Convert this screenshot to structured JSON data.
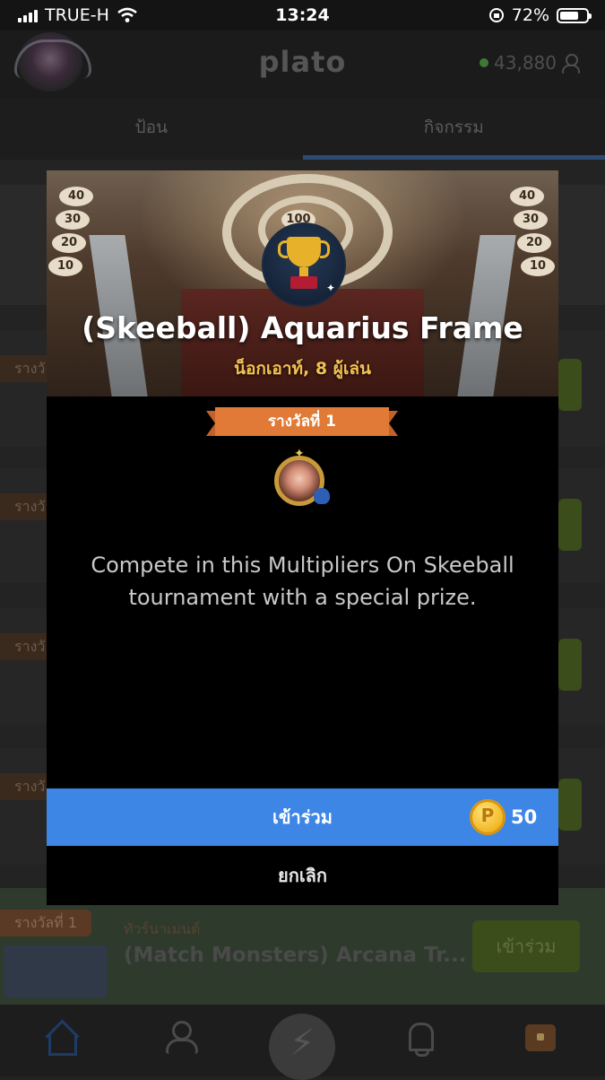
{
  "status_bar": {
    "carrier": "TRUE-H",
    "time": "13:24",
    "battery_percent": "72%",
    "battery_level": 0.72
  },
  "header": {
    "logo": "plato",
    "coins": "43,880"
  },
  "tabs": [
    {
      "label": "ป้อน"
    },
    {
      "label": "กิจกรรม"
    }
  ],
  "background_list": {
    "visible_row": {
      "badge": "รางวัลที่ 1",
      "subtitle": "ทัวร์นาเมนต์",
      "title": "(Match Monsters) Arcana Tr...",
      "button": "เข้าร่วม"
    },
    "partial_badges": [
      "รางวั",
      "รางวั",
      "รางวั",
      "รางวั"
    ]
  },
  "modal": {
    "hero_title": "(Skeeball) Aquarius Frame",
    "hero_subtitle": "น็อกเอาท์, 8 ผู้เล่น",
    "score_labels": {
      "l40": "40",
      "l30": "30",
      "l20": "20",
      "l10": "10",
      "l100": "100",
      "r40": "40",
      "r30": "30",
      "r20": "20",
      "r10": "10"
    },
    "prize_label": "รางวัลที่ 1",
    "description": "Compete in this Multipliers On Skeeball tournament with a special prize.",
    "join_label": "เข้าร่วม",
    "coin_symbol": "P",
    "cost": "50",
    "cancel_label": "ยกเลิก"
  },
  "colors": {
    "join_button": "#3d86e6",
    "prize_banner": "#e07a36",
    "hero_subtitle": "#f2c14e",
    "coin": "#f0b21c"
  },
  "icons": [
    "signal-icon",
    "wifi-icon",
    "orientation-lock-icon",
    "battery-icon",
    "profile-avatar",
    "user-icon",
    "trophy-icon",
    "frame-prize-icon",
    "coin-icon",
    "home-icon",
    "friends-icon",
    "bolt-icon",
    "bell-icon",
    "chest-icon"
  ]
}
